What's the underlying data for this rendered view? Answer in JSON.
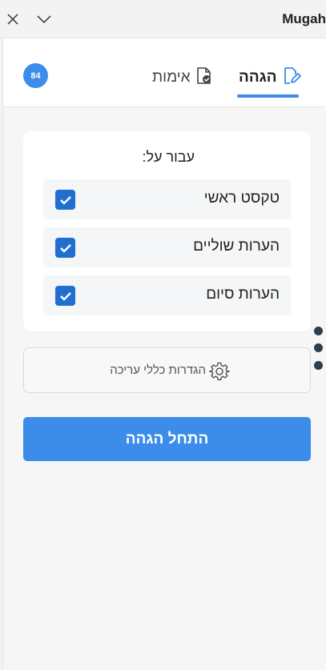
{
  "window": {
    "title": "Mugah",
    "close_icon": "close-icon",
    "minimize_icon": "chevron-down-icon"
  },
  "tabs": {
    "badge_count": "84",
    "items": [
      {
        "label": "הגהה",
        "icon": "edit-document-icon",
        "active": true
      },
      {
        "label": "אימות",
        "icon": "verified-document-icon",
        "active": false
      }
    ],
    "accent_color": "#3b8de9"
  },
  "scope": {
    "title": "עבור על:",
    "options": [
      {
        "label": "טקסט ראשי",
        "checked": true
      },
      {
        "label": "הערות שוליים",
        "checked": true
      },
      {
        "label": "הערות סיום",
        "checked": true
      }
    ],
    "checkbox_color": "#1f6fd1"
  },
  "settings": {
    "label": "הגדרות כללי עריכה",
    "icon": "gear-icon"
  },
  "side_menu_icon": "more-vertical-icon",
  "actions": {
    "start_label": "התחל הגהה"
  }
}
